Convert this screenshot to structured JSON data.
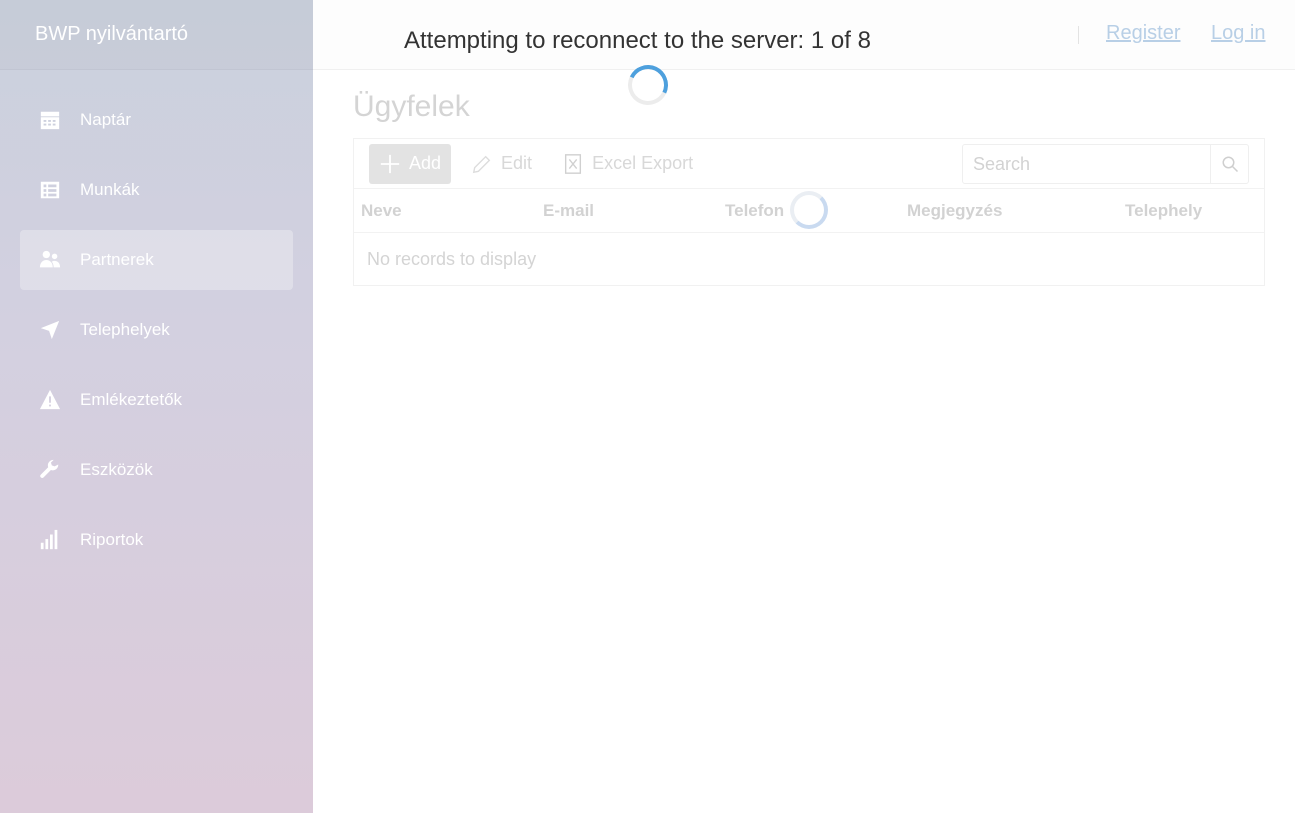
{
  "app": {
    "brand": "BWP nyilvántartó"
  },
  "sidebar": {
    "items": [
      {
        "label": "Naptár",
        "icon": "calendar-icon",
        "active": false
      },
      {
        "label": "Munkák",
        "icon": "list-icon",
        "active": false
      },
      {
        "label": "Partnerek",
        "icon": "users-icon",
        "active": true
      },
      {
        "label": "Telephelyek",
        "icon": "location-arrow-icon",
        "active": false
      },
      {
        "label": "Emlékeztetők",
        "icon": "warning-icon",
        "active": false
      },
      {
        "label": "Eszközök",
        "icon": "wrench-icon",
        "active": false
      },
      {
        "label": "Riportok",
        "icon": "signal-bars-icon",
        "active": false
      }
    ]
  },
  "topbar": {
    "register": "Register",
    "login": "Log in"
  },
  "reconnect": {
    "message": "Attempting to reconnect to the server: 1 of 8"
  },
  "page": {
    "title": "Ügyfelek"
  },
  "toolbar": {
    "add": "Add",
    "edit": "Edit",
    "excel_export": "Excel Export",
    "search_placeholder": "Search"
  },
  "grid": {
    "columns": [
      "Neve",
      "E-mail",
      "Telefon",
      "Megjegyzés",
      "Telephely"
    ],
    "empty_message": "No records to display"
  },
  "colors": {
    "accent": "#4ea0dd",
    "link": "#b8cfe6"
  }
}
